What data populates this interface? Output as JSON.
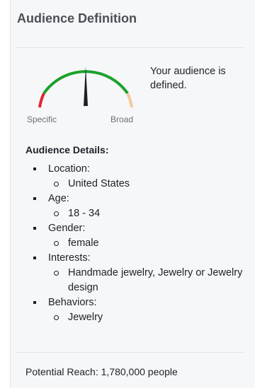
{
  "panel": {
    "title": "Audience Definition",
    "accent_color": "#1aa12b",
    "needle_color": "#1d2129"
  },
  "meter": {
    "left_label": "Specific",
    "right_label": "Broad",
    "segment_colors": {
      "specific": "#e0262f",
      "defined": "#1aa12b",
      "broad": "#f5c79b"
    },
    "level": 0.5
  },
  "status_text": "Your audience is defined.",
  "details": {
    "title": "Audience Details:",
    "items": [
      {
        "label": "Location:",
        "values": [
          "United States"
        ]
      },
      {
        "label": "Age:",
        "values": [
          "18 - 34"
        ]
      },
      {
        "label": "Gender:",
        "values": [
          "female"
        ]
      },
      {
        "label": "Interests:",
        "values": [
          "Handmade jewelry, Jewelry or Jewelry design"
        ]
      },
      {
        "label": "Behaviors:",
        "values": [
          "Jewelry"
        ]
      }
    ]
  },
  "reach_text": "Potential Reach: 1,780,000 people"
}
